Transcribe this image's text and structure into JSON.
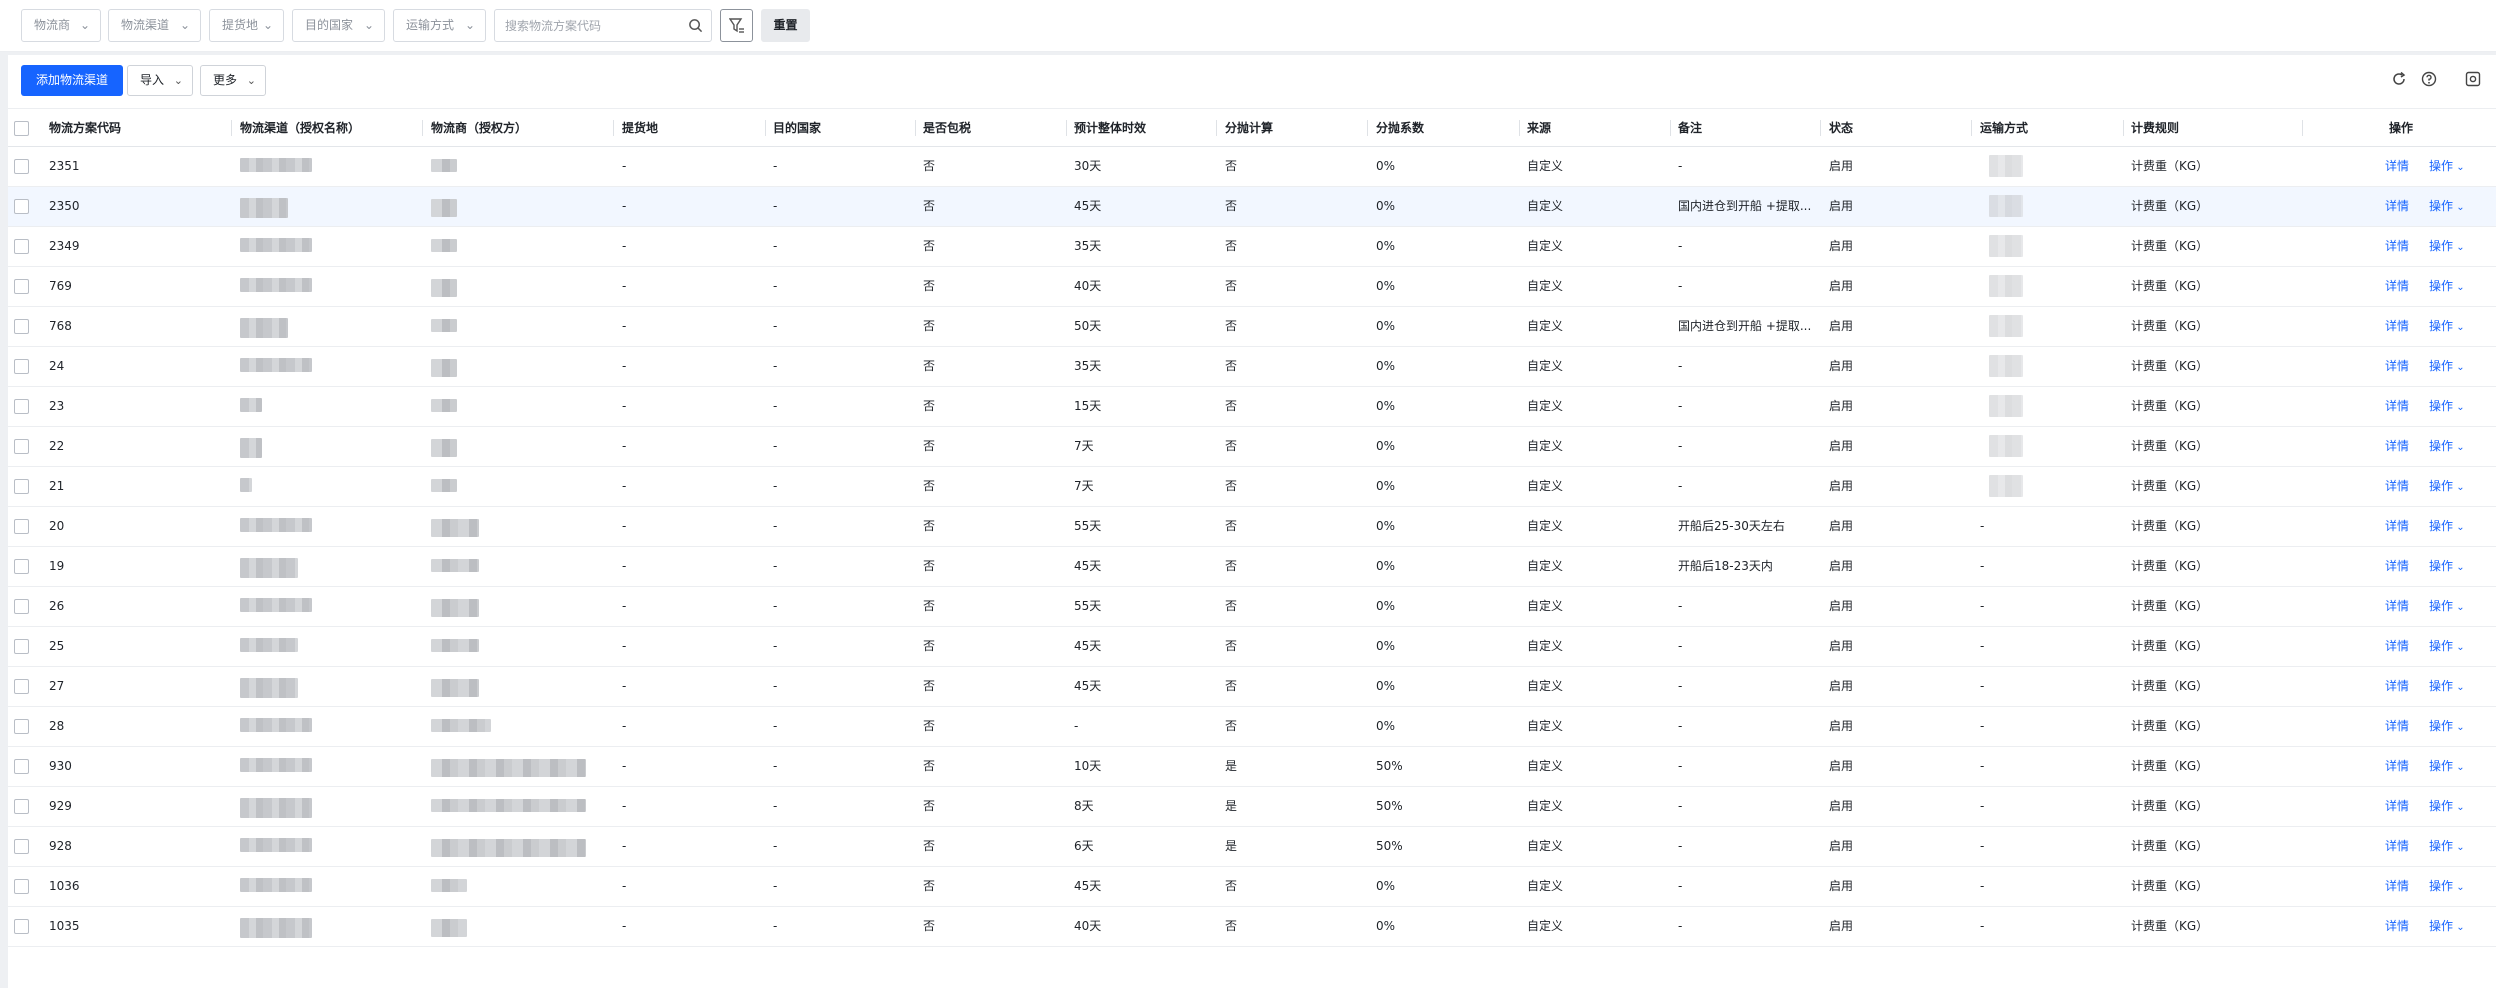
{
  "filters": {
    "carrier": "物流商",
    "channel": "物流渠道",
    "pickup": "提货地",
    "destination": "目的国家",
    "transport": "运输方式",
    "search_placeholder": "搜索物流方案代码",
    "reset_label": "重置"
  },
  "toolbar": {
    "add_label": "添加物流渠道",
    "import_label": "导入",
    "more_label": "更多"
  },
  "table": {
    "columns": [
      "物流方案代码",
      "物流渠道（授权名称）",
      "物流商（授权方）",
      "提货地",
      "目的国家",
      "是否包税",
      "预计整体时效",
      "分抛计算",
      "分抛系数",
      "来源",
      "备注",
      "状态",
      "运输方式",
      "计费规则",
      "操作"
    ],
    "detail_label": "详情",
    "ops_label": "操作",
    "rows": [
      {
        "code": "2351",
        "pickup": "-",
        "dest": "-",
        "tax": "否",
        "eta": "30天",
        "split": "否",
        "coef": "0%",
        "source": "自定义",
        "note": "-",
        "status": "启用",
        "transport": "",
        "rule": "计费重（KG）"
      },
      {
        "code": "2350",
        "pickup": "-",
        "dest": "-",
        "tax": "否",
        "eta": "45天",
        "split": "否",
        "coef": "0%",
        "source": "自定义",
        "note": "国内进仓到开船 +提取...",
        "status": "启用",
        "transport": "",
        "rule": "计费重（KG）"
      },
      {
        "code": "2349",
        "pickup": "-",
        "dest": "-",
        "tax": "否",
        "eta": "35天",
        "split": "否",
        "coef": "0%",
        "source": "自定义",
        "note": "-",
        "status": "启用",
        "transport": "",
        "rule": "计费重（KG）"
      },
      {
        "code": "769",
        "pickup": "-",
        "dest": "-",
        "tax": "否",
        "eta": "40天",
        "split": "否",
        "coef": "0%",
        "source": "自定义",
        "note": "-",
        "status": "启用",
        "transport": "",
        "rule": "计费重（KG）"
      },
      {
        "code": "768",
        "pickup": "-",
        "dest": "-",
        "tax": "否",
        "eta": "50天",
        "split": "否",
        "coef": "0%",
        "source": "自定义",
        "note": "国内进仓到开船 +提取...",
        "status": "启用",
        "transport": "",
        "rule": "计费重（KG）"
      },
      {
        "code": "24",
        "pickup": "-",
        "dest": "-",
        "tax": "否",
        "eta": "35天",
        "split": "否",
        "coef": "0%",
        "source": "自定义",
        "note": "-",
        "status": "启用",
        "transport": "",
        "rule": "计费重（KG）"
      },
      {
        "code": "23",
        "pickup": "-",
        "dest": "-",
        "tax": "否",
        "eta": "15天",
        "split": "否",
        "coef": "0%",
        "source": "自定义",
        "note": "-",
        "status": "启用",
        "transport": "",
        "rule": "计费重（KG）"
      },
      {
        "code": "22",
        "pickup": "-",
        "dest": "-",
        "tax": "否",
        "eta": "7天",
        "split": "否",
        "coef": "0%",
        "source": "自定义",
        "note": "-",
        "status": "启用",
        "transport": "",
        "rule": "计费重（KG）"
      },
      {
        "code": "21",
        "pickup": "-",
        "dest": "-",
        "tax": "否",
        "eta": "7天",
        "split": "否",
        "coef": "0%",
        "source": "自定义",
        "note": "-",
        "status": "启用",
        "transport": "",
        "rule": "计费重（KG）"
      },
      {
        "code": "20",
        "pickup": "-",
        "dest": "-",
        "tax": "否",
        "eta": "55天",
        "split": "否",
        "coef": "0%",
        "source": "自定义",
        "note": "开船后25-30天左右",
        "status": "启用",
        "transport": "-",
        "rule": "计费重（KG）"
      },
      {
        "code": "19",
        "pickup": "-",
        "dest": "-",
        "tax": "否",
        "eta": "45天",
        "split": "否",
        "coef": "0%",
        "source": "自定义",
        "note": "开船后18-23天内",
        "status": "启用",
        "transport": "-",
        "rule": "计费重（KG）"
      },
      {
        "code": "26",
        "pickup": "-",
        "dest": "-",
        "tax": "否",
        "eta": "55天",
        "split": "否",
        "coef": "0%",
        "source": "自定义",
        "note": "-",
        "status": "启用",
        "transport": "-",
        "rule": "计费重（KG）"
      },
      {
        "code": "25",
        "pickup": "-",
        "dest": "-",
        "tax": "否",
        "eta": "45天",
        "split": "否",
        "coef": "0%",
        "source": "自定义",
        "note": "-",
        "status": "启用",
        "transport": "-",
        "rule": "计费重（KG）"
      },
      {
        "code": "27",
        "pickup": "-",
        "dest": "-",
        "tax": "否",
        "eta": "45天",
        "split": "否",
        "coef": "0%",
        "source": "自定义",
        "note": "-",
        "status": "启用",
        "transport": "-",
        "rule": "计费重（KG）"
      },
      {
        "code": "28",
        "pickup": "-",
        "dest": "-",
        "tax": "否",
        "eta": "-",
        "split": "否",
        "coef": "0%",
        "source": "自定义",
        "note": "-",
        "status": "启用",
        "transport": "-",
        "rule": "计费重（KG）"
      },
      {
        "code": "930",
        "pickup": "-",
        "dest": "-",
        "tax": "否",
        "eta": "10天",
        "split": "是",
        "coef": "50%",
        "source": "自定义",
        "note": "-",
        "status": "启用",
        "transport": "-",
        "rule": "计费重（KG）"
      },
      {
        "code": "929",
        "pickup": "-",
        "dest": "-",
        "tax": "否",
        "eta": "8天",
        "split": "是",
        "coef": "50%",
        "source": "自定义",
        "note": "-",
        "status": "启用",
        "transport": "-",
        "rule": "计费重（KG）"
      },
      {
        "code": "928",
        "pickup": "-",
        "dest": "-",
        "tax": "否",
        "eta": "6天",
        "split": "是",
        "coef": "50%",
        "source": "自定义",
        "note": "-",
        "status": "启用",
        "transport": "-",
        "rule": "计费重（KG）"
      },
      {
        "code": "1036",
        "pickup": "-",
        "dest": "-",
        "tax": "否",
        "eta": "45天",
        "split": "否",
        "coef": "0%",
        "source": "自定义",
        "note": "-",
        "status": "启用",
        "transport": "-",
        "rule": "计费重（KG）"
      },
      {
        "code": "1035",
        "pickup": "-",
        "dest": "-",
        "tax": "否",
        "eta": "40天",
        "split": "否",
        "coef": "0%",
        "source": "自定义",
        "note": "-",
        "status": "启用",
        "transport": "-",
        "rule": "计费重（KG）"
      }
    ]
  },
  "icons": {
    "search": "search-icon",
    "filter_clear": "filter-clear-icon",
    "refresh": "refresh-icon",
    "help": "help-icon",
    "settings": "column-settings-icon"
  },
  "colors": {
    "primary": "#1664ff",
    "row_highlight": "#f2f7ff",
    "background_band": "#eef0f3"
  }
}
